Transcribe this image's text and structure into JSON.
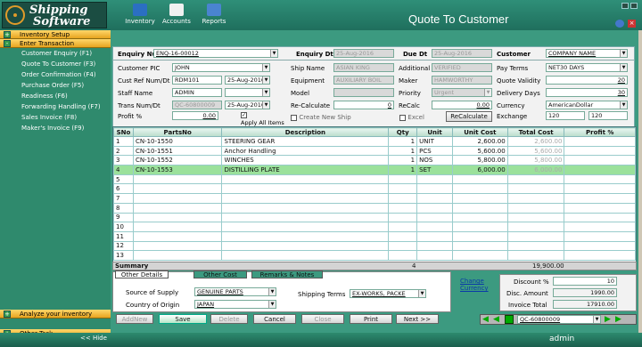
{
  "app": {
    "logo_line1": "Shipping",
    "logo_line2": "Software",
    "title": "Quote To Customer"
  },
  "toolbar": {
    "inventory": "Inventory",
    "accounts": "Accounts",
    "reports": "Reports"
  },
  "sidebar": {
    "section1": "Inventory Setup",
    "section2": "Enter Transaction",
    "items": [
      "Customer Enquiry (F1)",
      "Quote To Customer (F3)",
      "Order Confirmation (F4)",
      "Purchase Order (F5)",
      "Readiness (F6)",
      "Forwarding Handling (F7)",
      "Sales Invoice (F8)",
      "Maker's Invoice (F9)"
    ],
    "section3": "Analyze your inventory",
    "section4": "Other Task",
    "hide": "<< Hide"
  },
  "form": {
    "enquiry_num_label": "Enquiry Num",
    "enquiry_num": "ENQ-16-00012",
    "enquiry_dt_label": "Enquiry Dt",
    "enquiry_dt": "25-Aug-2016",
    "due_dt_label": "Due Dt",
    "due_dt": "25-Aug-2016",
    "customer_label": "Customer",
    "customer": "COMPANY NAME",
    "customer_pic_label": "Customer PIC",
    "customer_pic": "JOHN",
    "cust_ref_label": "Cust Ref Num/Dt",
    "cust_ref": "RDM101",
    "cust_ref_dt": "25-Aug-2016",
    "staff_label": "Staff  Name",
    "staff": "ADMIN",
    "trans_label": "Trans Num/Dt",
    "trans": "QC-60800009",
    "trans_dt": "25-Aug-2016",
    "profit_label": "Profit %",
    "profit": "0.00",
    "apply_all": "Apply All Items",
    "ship_name_label": "Ship Name",
    "ship_name": "ASIAN KING",
    "additional_label": "Additional",
    "additional": "VERIFIED",
    "equipment_label": "Equipment",
    "equipment": "AUXILIARY BOIL",
    "maker_label": "Maker",
    "maker": "HAMWORTHY",
    "model_label": "Model",
    "priority_label": "Priority",
    "priority": "Urgent",
    "recalc_label": "Re-Calculate",
    "recalc": "0",
    "recalc2_label": "ReCalc",
    "recalc2": "0.00",
    "create_ship": "Create New Ship",
    "excel": "Excel",
    "recalculate_btn": "ReCalculate",
    "pay_terms_label": "Pay Terms",
    "pay_terms": "NET30 DAYS",
    "quote_validity_label": "Quote Validity",
    "quote_validity": "20",
    "delivery_days_label": "Delivery Days",
    "delivery_days": "30",
    "currency_label": "Currency",
    "currency": "AmericanDollar",
    "exchange_label": "Exchange",
    "exchange1": "120",
    "exchange2": "120"
  },
  "grid": {
    "headers": [
      "SNo",
      "PartsNo",
      "Description",
      "Qty",
      "Unit",
      "Unit Cost",
      "Total Cost",
      "Profit %"
    ],
    "rows": [
      [
        "1",
        "CN-10-1550",
        "STEERING GEAR",
        "1",
        "UNIT",
        "2,600.00",
        "2,600.00",
        ""
      ],
      [
        "2",
        "CN-10-1551",
        "Anchor Handling",
        "1",
        "PCS",
        "5,600.00",
        "5,600.00",
        ""
      ],
      [
        "3",
        "CN-10-1552",
        "WINCHES",
        "1",
        "NOS",
        "5,800.00",
        "5,800.00",
        ""
      ],
      [
        "4",
        "CN-10-1553",
        "DISTILLING PLATE",
        "1",
        "SET",
        "6,000.00",
        "6,000.00",
        ""
      ],
      [
        "5",
        "",
        "",
        "",
        "",
        "",
        "",
        ""
      ],
      [
        "6",
        "",
        "",
        "",
        "",
        "",
        "",
        ""
      ],
      [
        "7",
        "",
        "",
        "",
        "",
        "",
        "",
        ""
      ],
      [
        "8",
        "",
        "",
        "",
        "",
        "",
        "",
        ""
      ],
      [
        "9",
        "",
        "",
        "",
        "",
        "",
        "",
        ""
      ],
      [
        "10",
        "",
        "",
        "",
        "",
        "",
        "",
        ""
      ],
      [
        "11",
        "",
        "",
        "",
        "",
        "",
        "",
        ""
      ],
      [
        "12",
        "",
        "",
        "",
        "",
        "",
        "",
        ""
      ],
      [
        "13",
        "",
        "",
        "",
        "",
        "",
        "",
        ""
      ]
    ],
    "summary_label": "Summary",
    "summary_qty": "4",
    "summary_total": "19,900.00"
  },
  "tabs": {
    "t1": "Other Details",
    "t2": "Other Cost",
    "t3": "Remarks & Notes",
    "supply_label": "Source of Supply",
    "supply": "GENUINE PARTS",
    "origin_label": "Country of Origin",
    "origin": "JAPAN",
    "shipping_label": "Shipping Terms",
    "shipping": "EX-WORKS, PACKE"
  },
  "change_currency": "Change Currency",
  "totals": {
    "discount_label": "Discount %",
    "discount": "10",
    "disc_amount_label": "Disc. Amount",
    "disc_amount": "1990.00",
    "invoice_total_label": "Invoice Total",
    "invoice_total": "17910.00"
  },
  "buttons": {
    "addnew": "AddNew",
    "save": "Save",
    "delete": "Delete",
    "cancel": "Cancel",
    "close": "Close",
    "print": "Print",
    "next": "Next >>"
  },
  "nav_record": "QC-60800009",
  "footer_user": "admin"
}
